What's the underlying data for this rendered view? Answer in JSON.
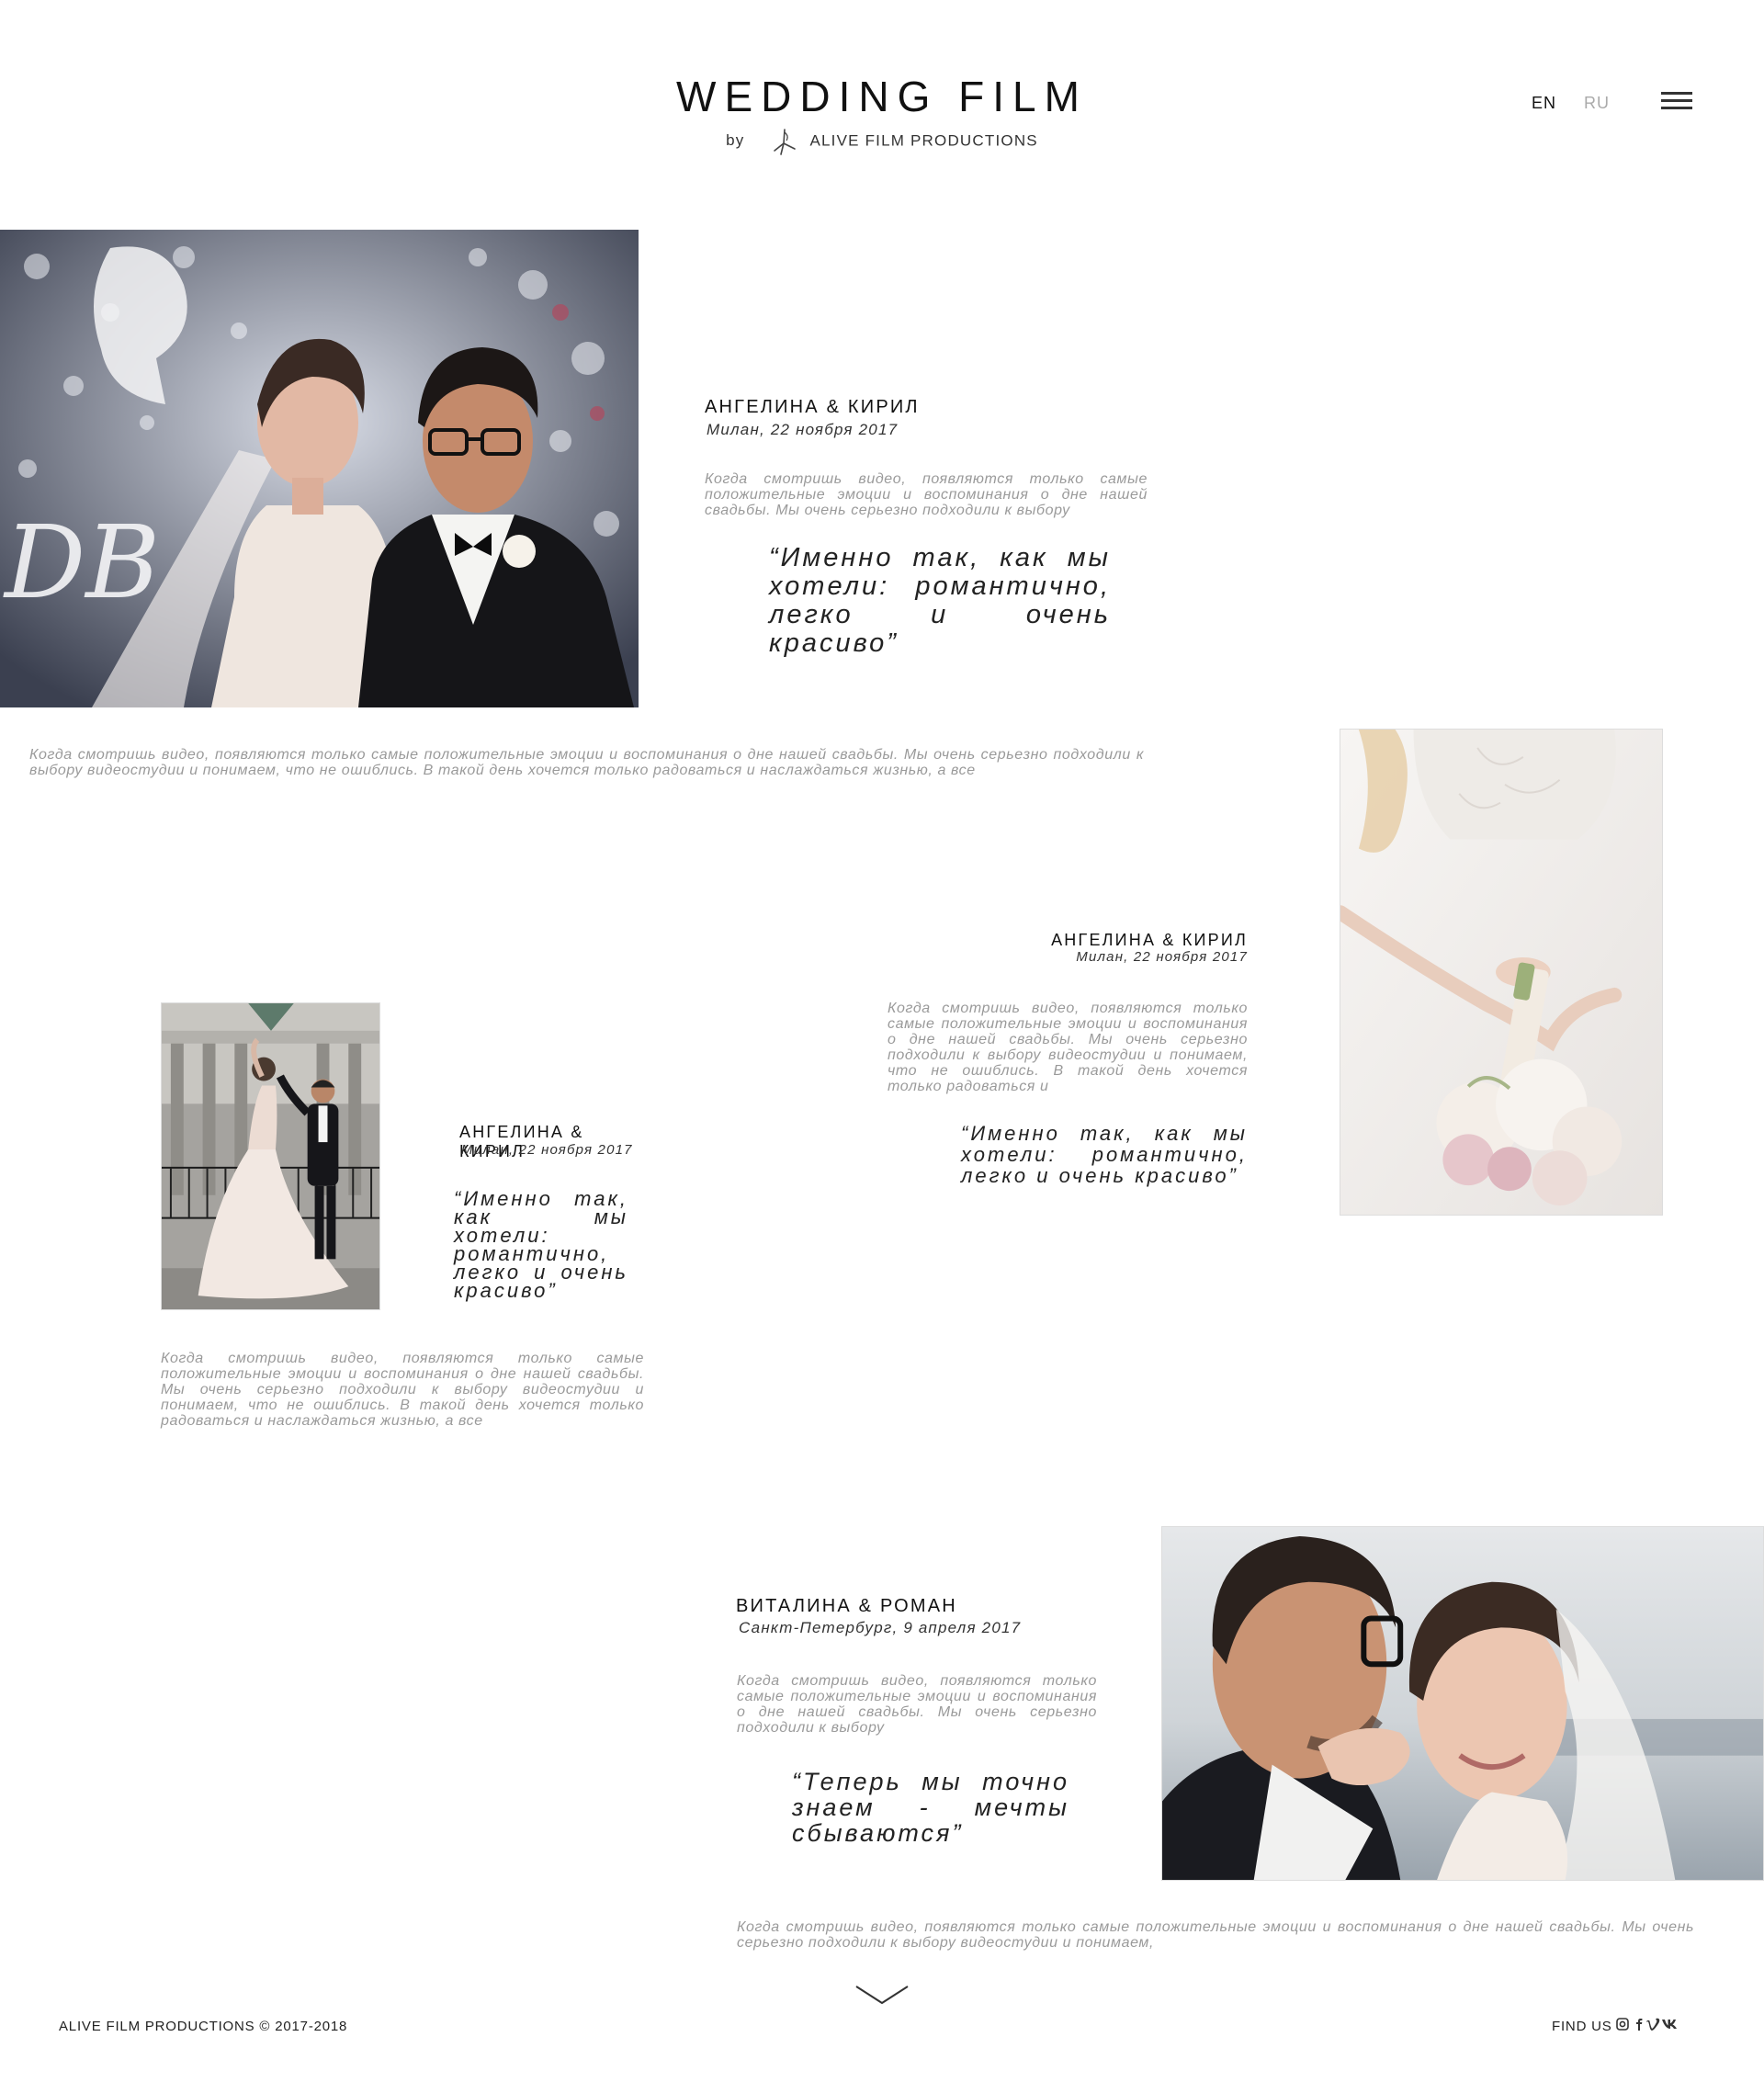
{
  "header": {
    "title": "WEDDING FILM",
    "by": "by",
    "company": "ALIVE FILM PRODUCTIONS",
    "lang_en": "EN",
    "lang_ru": "RU"
  },
  "stories": [
    {
      "couple": "АНГЕЛИНА & КИРИЛ",
      "date": "Милан, 22 ноября 2017",
      "body": "Когда смотришь видео, появляются только самые положительные эмоции и воспоминания о дне нашей свадьбы. Мы очень серьезно подходили к выбору",
      "quote": "“Именно так, как мы хотели: романтично, легко и очень красиво”",
      "wide_text": "Когда смотришь видео, появляются только самые положительные эмоции и воспоминания о дне нашей свадьбы. Мы очень серьезно подходили к выбору видеостудии и понимаем, что не ошиблись. В такой день хочется только радоваться и наслаждаться жизнью, а все"
    },
    {
      "couple": "АНГЕЛИНА & КИРИЛ",
      "date": "Милан, 22 ноября 2017",
      "body": "Когда смотришь видео, появляются только самые положительные эмоции и воспоминания о дне нашей свадьбы. Мы очень серьезно подходили к выбору видеостудии и понимаем, что не ошиблись. В такой день хочется только радоваться и",
      "quote": "“Именно так, как мы хотели: романтично, легко и очень красиво”"
    },
    {
      "couple": "АНГЕЛИНА & КИРИЛ",
      "date": "Милан, 22 ноября 2017",
      "quote": "“Именно так, как мы хотели: романтично, легко и очень красиво”",
      "body": "Когда смотришь видео, появляются только самые положительные эмоции и воспоминания о дне нашей свадьбы. Мы очень серьезно подходили к выбору видеостудии и понимаем, что не ошиблись. В такой день хочется только радоваться и наслаждаться жизнью, а все"
    },
    {
      "couple": "ВИТАЛИНА & РОМАН",
      "date": "Санкт-Петербург, 9 апреля 2017",
      "body": "Когда смотришь видео, появляются только самые положительные эмоции и воспоминания о дне нашей свадьбы. Мы очень серьезно подходили к выбору",
      "quote": "“Теперь мы точно знаем - мечты сбываются”",
      "wide_text": "Когда смотришь видео, появляются только самые положительные эмоции и воспоминания о дне нашей свадьбы. Мы очень серьезно подходили к выбору видеостудии и понимаем,"
    }
  ],
  "footer": {
    "copyright": "ALIVE FILM PRODUCTIONS © 2017-2018",
    "find_us": "FIND US",
    "social_icons": [
      "instagram-icon",
      "facebook-icon",
      "vimeo-icon",
      "vk-icon"
    ]
  },
  "colors": {
    "text_dark": "#111111",
    "text_muted": "#9a9a9a",
    "lang_inactive": "#aaaaaa",
    "background": "#ffffff"
  }
}
